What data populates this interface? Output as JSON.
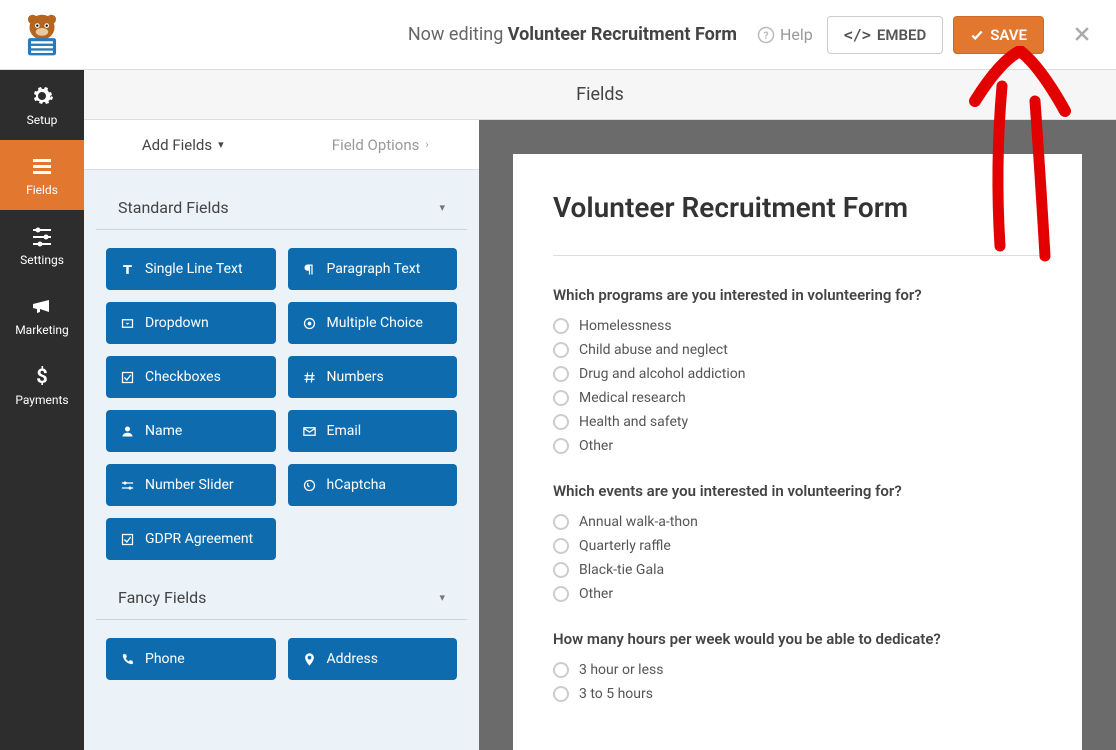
{
  "topbar": {
    "editing_prefix": "Now editing ",
    "form_name": "Volunteer Recruitment Form",
    "help": "Help",
    "embed": "EMBED",
    "save": "SAVE"
  },
  "nav": {
    "setup": "Setup",
    "fields": "Fields",
    "settings": "Settings",
    "marketing": "Marketing",
    "payments": "Payments"
  },
  "subheader": "Fields",
  "tabs": {
    "add": "Add Fields",
    "options": "Field Options"
  },
  "groups": {
    "standard": "Standard Fields",
    "fancy": "Fancy Fields"
  },
  "fields": {
    "single_line": "Single Line Text",
    "paragraph": "Paragraph Text",
    "dropdown": "Dropdown",
    "multiple": "Multiple Choice",
    "checkboxes": "Checkboxes",
    "numbers": "Numbers",
    "name": "Name",
    "email": "Email",
    "slider": "Number Slider",
    "hcaptcha": "hCaptcha",
    "gdpr": "GDPR Agreement",
    "phone": "Phone",
    "address": "Address"
  },
  "form": {
    "title": "Volunteer Recruitment Form",
    "q1": {
      "label": "Which programs are you interested in volunteering for?",
      "opts": [
        "Homelessness",
        "Child abuse and neglect",
        "Drug and alcohol addiction",
        "Medical research",
        "Health and safety",
        "Other"
      ]
    },
    "q2": {
      "label": "Which events are you interested in volunteering for?",
      "opts": [
        "Annual walk-a-thon",
        "Quarterly raffle",
        "Black-tie Gala",
        "Other"
      ]
    },
    "q3": {
      "label": "How many hours per week would you be able to dedicate?",
      "opts": [
        "3 hour or less",
        "3 to 5 hours"
      ]
    }
  }
}
